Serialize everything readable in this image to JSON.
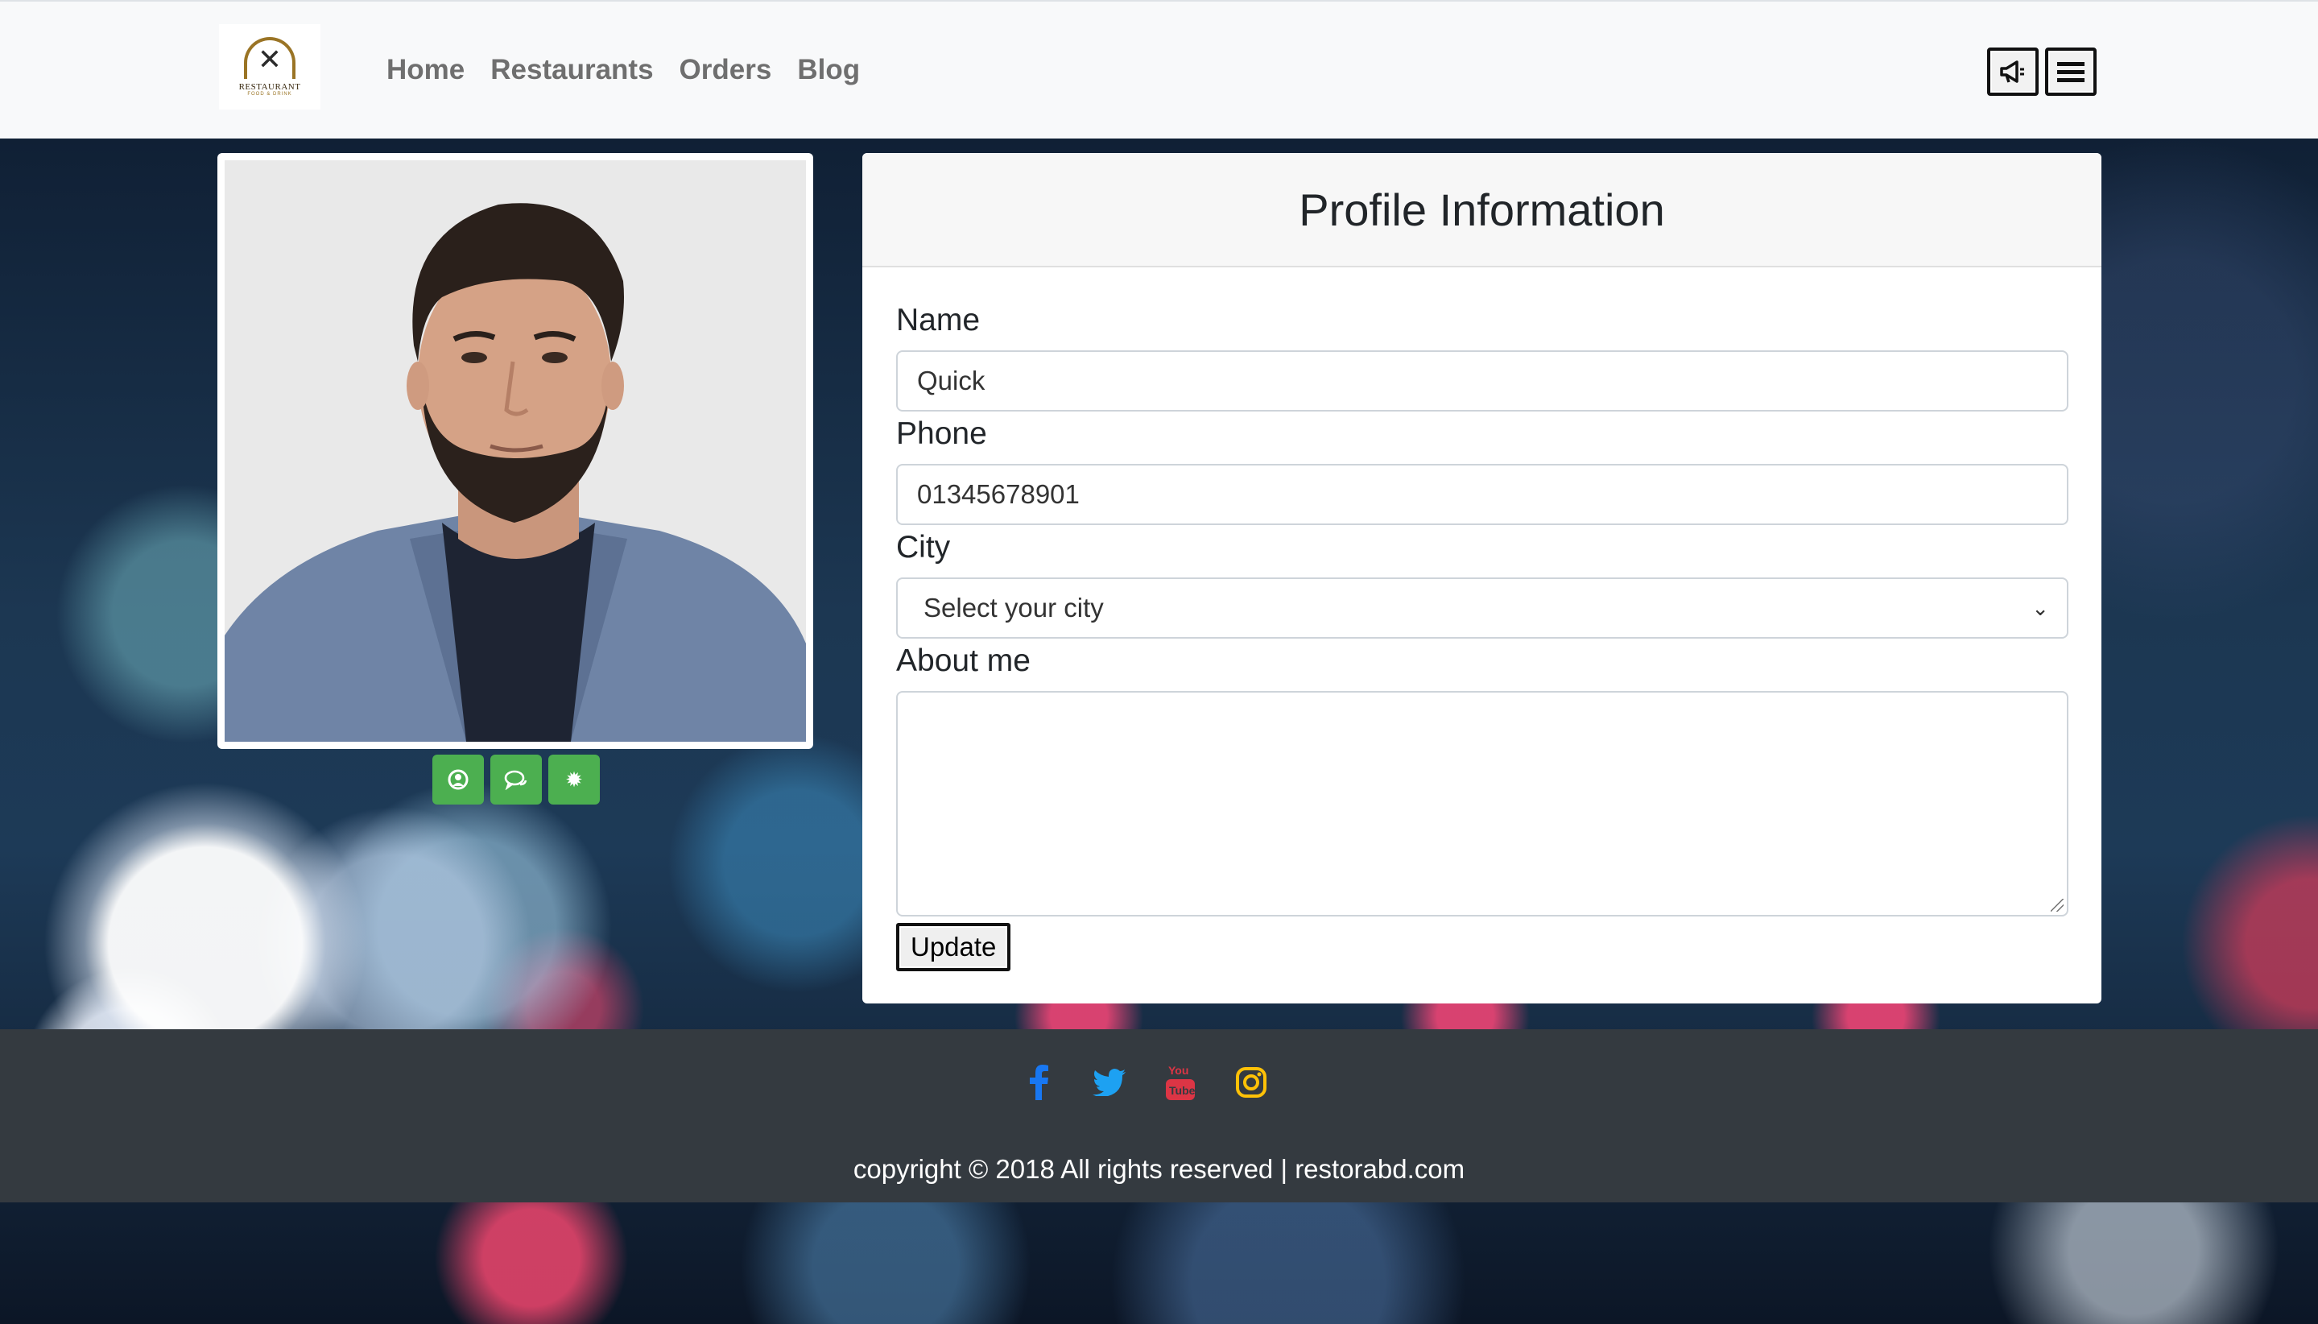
{
  "header": {
    "logo": {
      "text": "RESTAURANT",
      "sub": "FOOD & DRINK"
    },
    "nav": [
      {
        "label": "Home"
      },
      {
        "label": "Restaurants"
      },
      {
        "label": "Orders"
      },
      {
        "label": "Blog"
      }
    ],
    "icons": {
      "announce": "megaphone-icon",
      "menu": "hamburger-menu-icon"
    }
  },
  "profile_photo": {
    "alt": "profile photo of bearded man in blue blazer",
    "actions": [
      "user-circle-icon",
      "chat-icon",
      "gear-icon"
    ],
    "accent": "#4caf50"
  },
  "form": {
    "title": "Profile Information",
    "name_label": "Name",
    "name_value": "Quick",
    "phone_label": "Phone",
    "phone_value": "01345678901",
    "city_label": "City",
    "city_selected": "Select your city",
    "about_label": "About me",
    "about_value": "",
    "submit_label": "Update"
  },
  "footer": {
    "socials": [
      {
        "name": "facebook-icon",
        "color": "#1877f2"
      },
      {
        "name": "twitter-icon",
        "color": "#1da1f2"
      },
      {
        "name": "youtube-icon",
        "color": "#dc3545"
      },
      {
        "name": "instagram-icon",
        "color": "#ffc107"
      }
    ],
    "copyright": "copyright © 2018 All rights reserved  |  restorabd.com",
    "background": "#343a40"
  }
}
